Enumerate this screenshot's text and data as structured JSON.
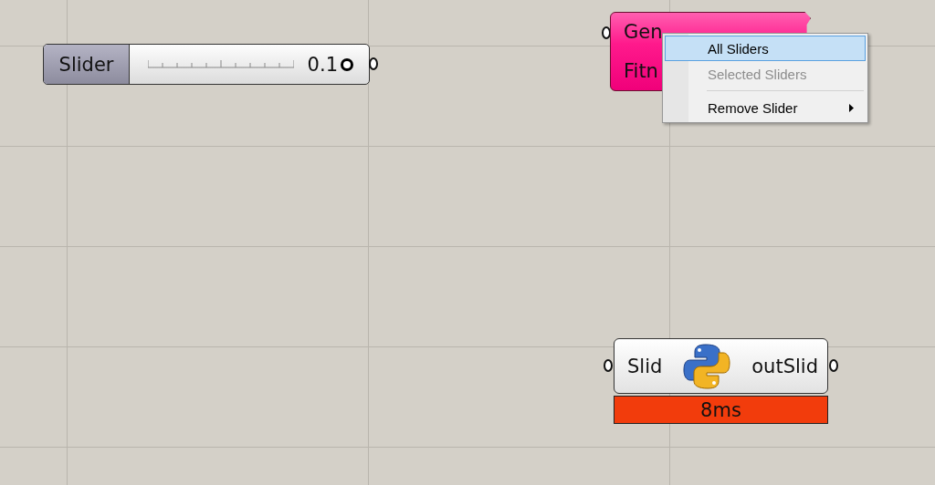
{
  "slider": {
    "label": "Slider",
    "value": "0.1",
    "level": 1
  },
  "genome_component": {
    "inputs": [
      "Gen",
      "Fitn"
    ]
  },
  "context_menu": {
    "items": [
      {
        "kind": "item",
        "label": "All Sliders",
        "selected": true,
        "disabled": false,
        "submenu": false
      },
      {
        "kind": "item",
        "label": "Selected Sliders",
        "selected": false,
        "disabled": true,
        "submenu": false
      },
      {
        "kind": "separator"
      },
      {
        "kind": "item",
        "label": "Remove Slider",
        "selected": false,
        "disabled": false,
        "submenu": true
      }
    ]
  },
  "python_component": {
    "input": "Slid",
    "output": "outSlid",
    "runtime": "8ms"
  }
}
